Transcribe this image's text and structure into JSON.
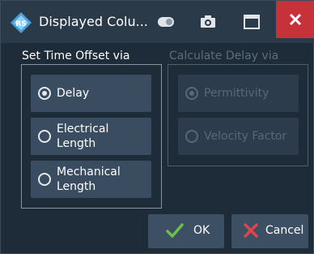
{
  "window": {
    "title": "Displayed Colu...",
    "logo_icon": "rohde-schwarz-logo-icon",
    "toolbar_icons": [
      "toggle-icon",
      "camera-icon",
      "maximize-icon",
      "close-icon"
    ]
  },
  "left_group": {
    "title": "Set Time Offset via",
    "options": [
      {
        "label": "Delay",
        "checked": true
      },
      {
        "label": "Electrical Length",
        "checked": false
      },
      {
        "label": "Mechanical\nLength",
        "checked": false
      }
    ]
  },
  "right_group": {
    "title": "Calculate Delay via",
    "disabled": true,
    "options": [
      {
        "label": "Permittivity",
        "checked": true
      },
      {
        "label": "Velocity Factor",
        "checked": false
      }
    ]
  },
  "buttons": {
    "ok_label": "OK",
    "cancel_label": "Cancel"
  },
  "colors": {
    "background": "#1e2b38",
    "titlebar": "#2b3a49",
    "close_button": "#c6313a",
    "button": "#3d4f62",
    "ok_check": "#6cc04a",
    "cancel_x": "#e0444d"
  }
}
